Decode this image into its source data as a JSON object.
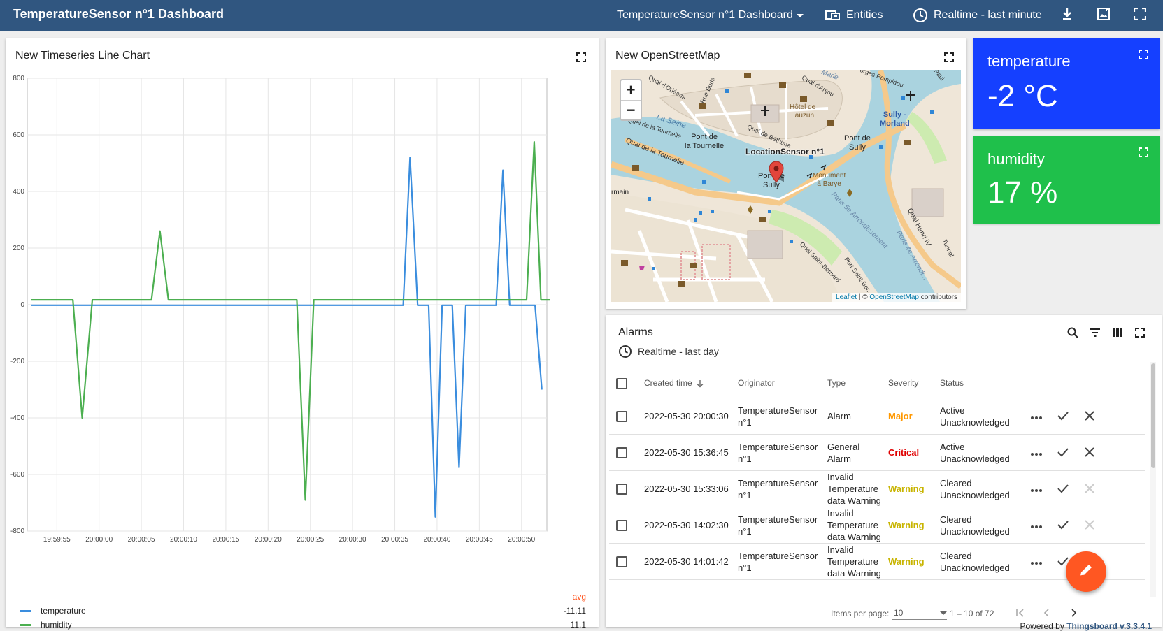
{
  "topbar": {
    "title": "TemperatureSensor n°1 Dashboard",
    "dashboard_select": "TemperatureSensor n°1 Dashboard",
    "entities_label": "Entities",
    "timewindow_label": "Realtime - last minute"
  },
  "chart": {
    "title": "New Timeseries Line Chart",
    "avg_label": "avg"
  },
  "chart_data": {
    "type": "line",
    "title": "New Timeseries Line Chart",
    "xlabel": "",
    "ylabel": "",
    "ylim": [
      -800,
      800
    ],
    "yticks": [
      -800,
      -600,
      -400,
      -200,
      0,
      200,
      400,
      600,
      800
    ],
    "xticks": [
      "19:59:55",
      "20:00:00",
      "20:00:05",
      "20:00:10",
      "20:00:15",
      "20:00:20",
      "20:00:25",
      "20:00:30",
      "20:00:35",
      "20:00:40",
      "20:00:45",
      "20:00:50"
    ],
    "xlim_seconds": [
      -58,
      0
    ],
    "grid": true,
    "legend_placement": "bottom",
    "series": [
      {
        "name": "temperature",
        "color": "#3a8dde",
        "avg": "-11.11",
        "points": [
          [
            -58,
            -2
          ],
          [
            -53,
            -2
          ],
          [
            -50,
            -2
          ],
          [
            -47,
            -2
          ],
          [
            -40,
            -2
          ],
          [
            -35,
            -2
          ],
          [
            -30,
            -2
          ],
          [
            -25,
            -2
          ],
          [
            -22,
            -2
          ],
          [
            -20,
            -2
          ],
          [
            -17,
            -2
          ],
          [
            -15,
            -2
          ],
          [
            -14,
            -2
          ],
          [
            -14,
            0
          ],
          [
            -13.2,
            520
          ],
          [
            -12.3,
            -2
          ],
          [
            -11,
            -2
          ],
          [
            -10.2,
            -750
          ],
          [
            -9.4,
            -2
          ],
          [
            -8.2,
            -2
          ],
          [
            -7.4,
            -575
          ],
          [
            -6.6,
            -2
          ],
          [
            -4,
            -2
          ],
          [
            -3,
            -2
          ],
          [
            -2.2,
            475
          ],
          [
            -1.4,
            -2
          ],
          [
            1.6,
            -2
          ],
          [
            2.4,
            -300
          ]
        ]
      },
      {
        "name": "humidity",
        "color": "#4caf50",
        "avg": "11.1",
        "points": [
          [
            -58,
            17
          ],
          [
            -53.1,
            17
          ],
          [
            -52,
            -400
          ],
          [
            -50.8,
            17
          ],
          [
            -43.8,
            17
          ],
          [
            -42.8,
            260
          ],
          [
            -41.8,
            17
          ],
          [
            -26.6,
            17
          ],
          [
            -25.6,
            -690
          ],
          [
            -24.6,
            17
          ],
          [
            -14,
            17
          ],
          [
            -12,
            17
          ],
          [
            -8,
            17
          ],
          [
            -4,
            17
          ],
          [
            -2,
            17
          ],
          [
            0,
            17
          ],
          [
            0.6,
            17
          ],
          [
            1.5,
            575
          ],
          [
            2.3,
            17
          ],
          [
            3.4,
            17
          ]
        ]
      }
    ]
  },
  "map": {
    "title": "New OpenStreetMap",
    "marker_label": "LocationSensor n°1",
    "attribution_leaflet": "Leaflet",
    "attribution_sep": " | © ",
    "attribution_osm": "OpenStreetMap",
    "attribution_tail": " contributors",
    "labels": [
      {
        "text": "Pont de",
        "k": "pont1a"
      },
      {
        "text": "la Tournelle",
        "k": "pont1b"
      },
      {
        "text": "Pont de",
        "k": "pont2a"
      },
      {
        "text": "Sully",
        "k": "pont2b"
      },
      {
        "text": "Pont de",
        "k": "pont3a"
      },
      {
        "text": "Sully",
        "k": "pont3b"
      },
      {
        "text": "Sully -",
        "k": "sullya"
      },
      {
        "text": "Morland",
        "k": "sullyb"
      },
      {
        "text": "Hôtel de",
        "k": "hotela"
      },
      {
        "text": "Lauzun",
        "k": "hotelb"
      },
      {
        "text": "Monument",
        "k": "monua"
      },
      {
        "text": "à Barye",
        "k": "monub"
      },
      {
        "text": "La Seine",
        "k": "seine"
      },
      {
        "text": "Quai de la Tournelle",
        "k": "quai1"
      },
      {
        "text": "Quai de la Tournelle",
        "k": "quai2"
      },
      {
        "text": "Quai d'Orléans",
        "k": "quai3"
      },
      {
        "text": "Quai d'Anjou",
        "k": "quai4"
      },
      {
        "text": "Quai de Béthune",
        "k": "quai5"
      },
      {
        "text": "Quai Henri IV",
        "k": "quai6"
      },
      {
        "text": "Paris 5e Arrondissement",
        "k": "arr5"
      },
      {
        "text": "Paris 4e Arrondi...",
        "k": "arr4"
      },
      {
        "text": "Quai Saint-Bernard",
        "k": "qsb"
      },
      {
        "text": "Port Saint-Ber...",
        "k": "psb"
      },
      {
        "text": "rmain",
        "k": "rmain"
      },
      {
        "text": "Tunnel",
        "k": "tunnel"
      },
      {
        "text": "Rue Budé",
        "k": "bude"
      },
      {
        "text": "Marie",
        "k": "marie"
      },
      {
        "text": "Paul",
        "k": "paul"
      },
      {
        "text": "orges Pompidou",
        "k": "pompidou"
      }
    ]
  },
  "temperature_card": {
    "label": "temperature",
    "value": "-2 °C",
    "color": "#1540ff"
  },
  "humidity_card": {
    "label": "humidity",
    "value": "17 %",
    "color": "#1fc04b"
  },
  "alarms": {
    "title": "Alarms",
    "timewindow": "Realtime - last day",
    "columns": [
      "Created time",
      "Originator",
      "Type",
      "Severity",
      "Status"
    ],
    "rows": [
      {
        "time": "2022-05-30 20:00:30",
        "originator_1": "TemperatureSensor",
        "originator_2": "n°1",
        "type": [
          "Alarm"
        ],
        "severity": "Major",
        "status_1": "Active",
        "status_2": "Unacknowledged",
        "cleared": false
      },
      {
        "time": "2022-05-30 15:36:45",
        "originator_1": "TemperatureSensor",
        "originator_2": "n°1",
        "type": [
          "General",
          "Alarm"
        ],
        "severity": "Critical",
        "status_1": "Active",
        "status_2": "Unacknowledged",
        "cleared": false
      },
      {
        "time": "2022-05-30 15:33:06",
        "originator_1": "TemperatureSensor",
        "originator_2": "n°1",
        "type": [
          "Invalid",
          "Temperature",
          "data Warning"
        ],
        "severity": "Warning",
        "status_1": "Cleared",
        "status_2": "Unacknowledged",
        "cleared": true
      },
      {
        "time": "2022-05-30 14:02:30",
        "originator_1": "TemperatureSensor",
        "originator_2": "n°1",
        "type": [
          "Invalid",
          "Temperature",
          "data Warning"
        ],
        "severity": "Warning",
        "status_1": "Cleared",
        "status_2": "Unacknowledged",
        "cleared": true
      },
      {
        "time": "2022-05-30 14:01:42",
        "originator_1": "TemperatureSensor",
        "originator_2": "n°1",
        "type": [
          "Invalid",
          "Temperature",
          "data Warning"
        ],
        "severity": "Warning",
        "status_1": "Cleared",
        "status_2": "Unacknowledged",
        "cleared": true
      }
    ],
    "severity_colors": {
      "Major": "#ff9800",
      "Critical": "#e00000",
      "Warning": "#c8b400"
    },
    "items_per_page_label": "Items per page:",
    "items_per_page": "10",
    "range": "1 – 10 of 72"
  },
  "footer": {
    "powered_by": "Powered by ",
    "brand": "Thingsboard v.3.3.4.1"
  }
}
